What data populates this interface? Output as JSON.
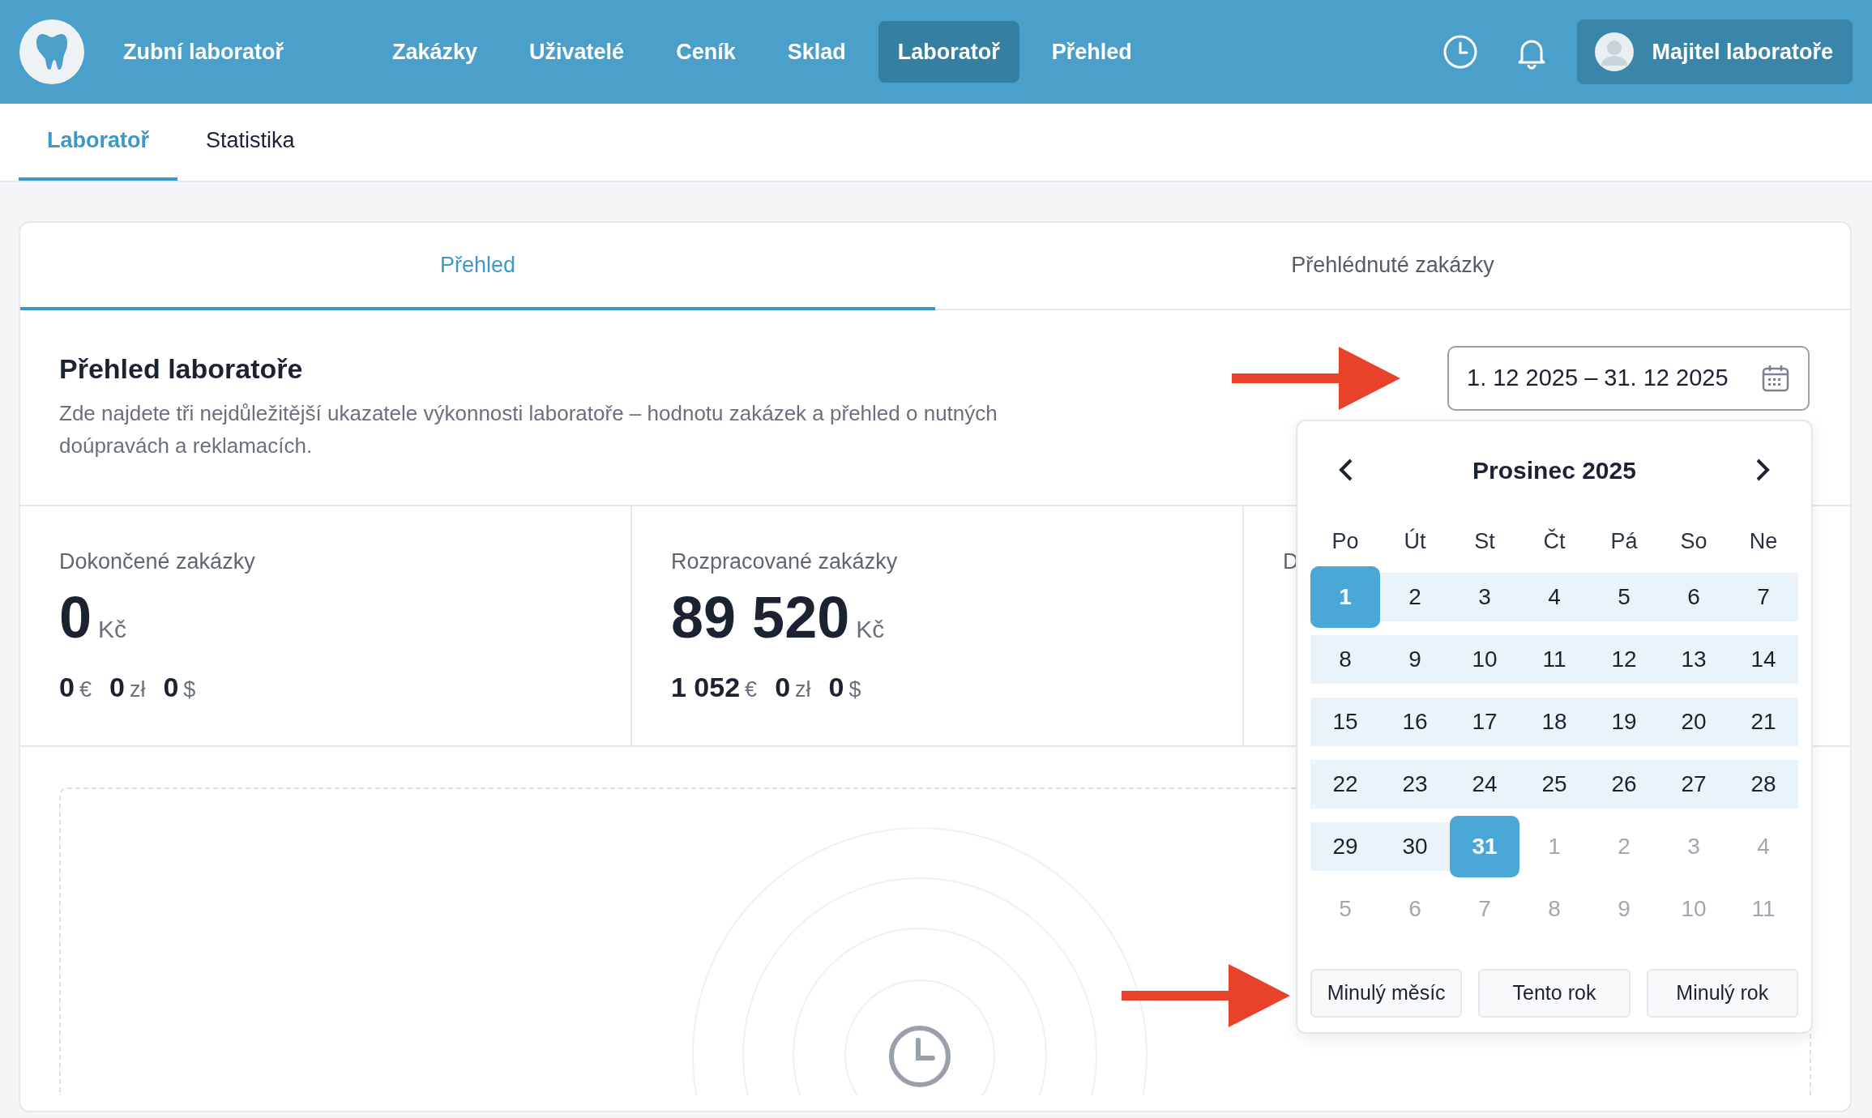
{
  "navbar": {
    "brand": "Zubní laboratoř",
    "items": [
      {
        "label": "Zakázky",
        "selected": false
      },
      {
        "label": "Uživatelé",
        "selected": false
      },
      {
        "label": "Ceník",
        "selected": false
      },
      {
        "label": "Sklad",
        "selected": false
      },
      {
        "label": "Laboratoř",
        "selected": true
      },
      {
        "label": "Přehled",
        "selected": false
      }
    ],
    "user": "Majitel laboratoře"
  },
  "subtabs": [
    {
      "label": "Laboratoř",
      "selected": true
    },
    {
      "label": "Statistika",
      "selected": false
    }
  ],
  "card": {
    "tabs": [
      {
        "label": "Přehled",
        "selected": true
      },
      {
        "label": "Přehlédnuté zakázky",
        "selected": false
      }
    ],
    "title": "Přehled laboratoře",
    "description": "Zde najdete tři nejdůležitější ukazatele výkonnosti laboratoře – hodnotu zakázek a přehled o nutných doúpravách a reklamacích.",
    "date_range": "1. 12 2025 – 31. 12 2025",
    "stats": [
      {
        "label": "Dokončené zakázky",
        "amount": "0",
        "currency": "Kč",
        "others": [
          {
            "amount": "0",
            "currency": "€"
          },
          {
            "amount": "0",
            "currency": "zł"
          },
          {
            "amount": "0",
            "currency": "$"
          }
        ]
      },
      {
        "label": "Rozpracované zakázky",
        "amount": "89 520",
        "currency": "Kč",
        "others": [
          {
            "amount": "1 052",
            "currency": "€"
          },
          {
            "amount": "0",
            "currency": "zł"
          },
          {
            "amount": "0",
            "currency": "$"
          }
        ]
      },
      {
        "label": "D"
      }
    ]
  },
  "calendar": {
    "month": "Prosinec 2025",
    "weekdays": [
      "Po",
      "Út",
      "St",
      "Čt",
      "Pá",
      "So",
      "Ne"
    ],
    "weeks": [
      [
        {
          "label": "1",
          "kind": "edge"
        },
        {
          "label": "2",
          "kind": "range"
        },
        {
          "label": "3",
          "kind": "range"
        },
        {
          "label": "4",
          "kind": "range"
        },
        {
          "label": "5",
          "kind": "range"
        },
        {
          "label": "6",
          "kind": "range"
        },
        {
          "label": "7",
          "kind": "range"
        }
      ],
      [
        {
          "label": "8",
          "kind": "range"
        },
        {
          "label": "9",
          "kind": "range"
        },
        {
          "label": "10",
          "kind": "range"
        },
        {
          "label": "11",
          "kind": "range"
        },
        {
          "label": "12",
          "kind": "range"
        },
        {
          "label": "13",
          "kind": "range"
        },
        {
          "label": "14",
          "kind": "range"
        }
      ],
      [
        {
          "label": "15",
          "kind": "range"
        },
        {
          "label": "16",
          "kind": "range"
        },
        {
          "label": "17",
          "kind": "range"
        },
        {
          "label": "18",
          "kind": "range"
        },
        {
          "label": "19",
          "kind": "range"
        },
        {
          "label": "20",
          "kind": "range"
        },
        {
          "label": "21",
          "kind": "range"
        }
      ],
      [
        {
          "label": "22",
          "kind": "range"
        },
        {
          "label": "23",
          "kind": "range"
        },
        {
          "label": "24",
          "kind": "range"
        },
        {
          "label": "25",
          "kind": "range"
        },
        {
          "label": "26",
          "kind": "range"
        },
        {
          "label": "27",
          "kind": "range"
        },
        {
          "label": "28",
          "kind": "range"
        }
      ],
      [
        {
          "label": "29",
          "kind": "range"
        },
        {
          "label": "30",
          "kind": "range"
        },
        {
          "label": "31",
          "kind": "edge"
        },
        {
          "label": "1",
          "kind": "other"
        },
        {
          "label": "2",
          "kind": "other"
        },
        {
          "label": "3",
          "kind": "other"
        },
        {
          "label": "4",
          "kind": "other"
        }
      ],
      [
        {
          "label": "5",
          "kind": "other"
        },
        {
          "label": "6",
          "kind": "other"
        },
        {
          "label": "7",
          "kind": "other"
        },
        {
          "label": "8",
          "kind": "other"
        },
        {
          "label": "9",
          "kind": "other"
        },
        {
          "label": "10",
          "kind": "other"
        },
        {
          "label": "11",
          "kind": "other"
        }
      ]
    ],
    "presets": [
      "Minulý měsíc",
      "Tento rok",
      "Minulý rok"
    ]
  }
}
